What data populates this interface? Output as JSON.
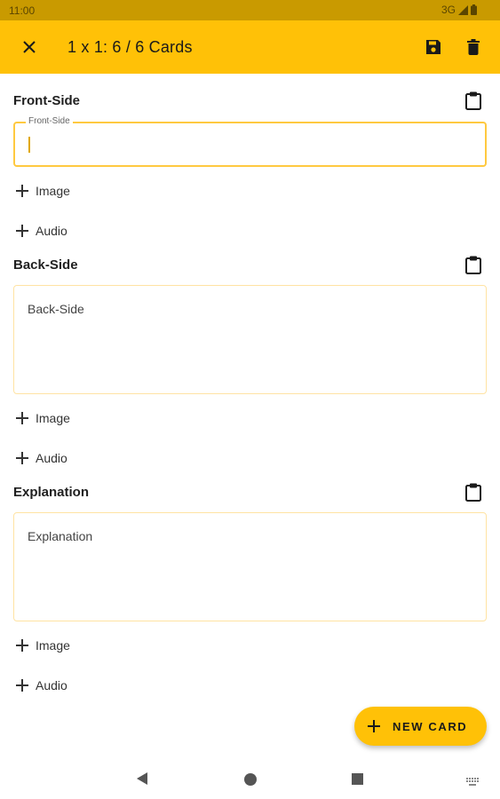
{
  "status_bar": {
    "time": "11:00",
    "network": "3G"
  },
  "app_bar": {
    "title": "1 x 1: 6 / 6 Cards"
  },
  "sections": [
    {
      "title": "Front-Side",
      "field_label": "Front-Side",
      "field_placeholder": "",
      "image_label": "Image",
      "audio_label": "Audio"
    },
    {
      "title": "Back-Side",
      "field_label": "",
      "field_placeholder": "Back-Side",
      "image_label": "Image",
      "audio_label": "Audio"
    },
    {
      "title": "Explanation",
      "field_label": "",
      "field_placeholder": "Explanation",
      "image_label": "Image",
      "audio_label": "Audio"
    }
  ],
  "fab": {
    "label": "NEW CARD"
  },
  "colors": {
    "primary": "#FFC107",
    "status_bar": "#C99A00",
    "field_border": "#FFE3A3"
  },
  "icons": {
    "close": "close-icon",
    "save": "save-icon",
    "delete": "delete-icon",
    "clipboard": "clipboard-icon",
    "add": "plus-icon"
  }
}
